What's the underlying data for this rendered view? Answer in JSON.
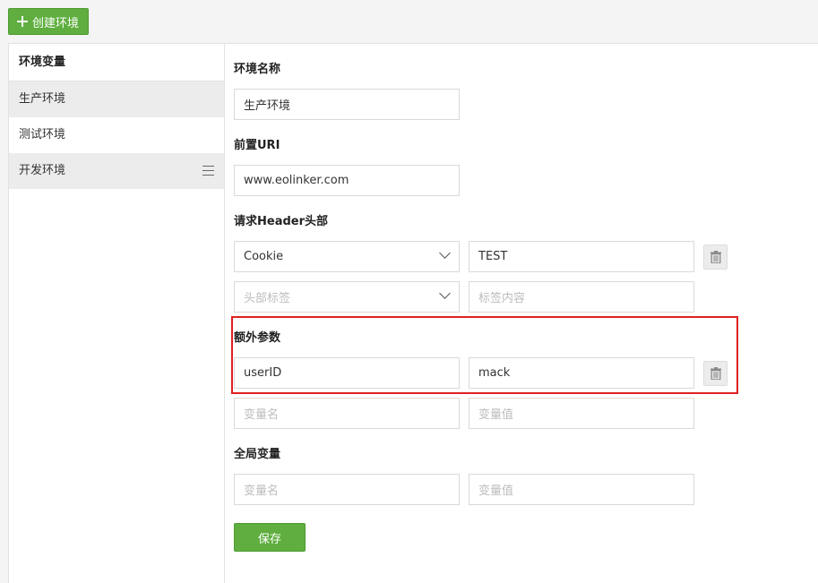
{
  "toolbar": {
    "create_label": "创建环境"
  },
  "sidebar": {
    "title": "环境变量",
    "items": [
      {
        "label": "生产环境"
      },
      {
        "label": "测试环境"
      },
      {
        "label": "开发环境"
      }
    ]
  },
  "form": {
    "env_name": {
      "label": "环境名称",
      "value": "生产环境"
    },
    "prefix_uri": {
      "label": "前置URI",
      "value": "www.eolinker.com"
    },
    "headers": {
      "label": "请求Header头部",
      "rows": [
        {
          "key": "Cookie",
          "value": "TEST"
        }
      ],
      "new_row": {
        "key_placeholder": "头部标签",
        "value_placeholder": "标签内容"
      }
    },
    "extra_params": {
      "label": "额外参数",
      "rows": [
        {
          "key": "userID",
          "value": "mack"
        }
      ],
      "new_row": {
        "key_placeholder": "变量名",
        "value_placeholder": "变量值"
      }
    },
    "global_vars": {
      "label": "全局变量",
      "new_row": {
        "key_placeholder": "变量名",
        "value_placeholder": "变量值"
      }
    },
    "save_label": "保存"
  },
  "colors": {
    "accent": "#5fae3f",
    "highlight": "#e02020"
  },
  "icons": {
    "create": "plus-icon",
    "menu": "hamburger-menu-icon",
    "select": "chevron-down-icon",
    "delete": "trash-icon"
  }
}
